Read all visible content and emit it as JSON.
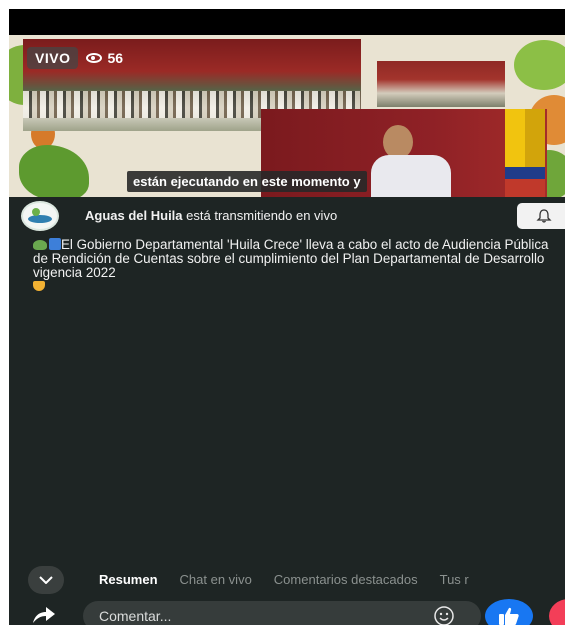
{
  "video": {
    "live_label": "VIVO",
    "viewer_count": "56",
    "caption": "están ejecutando en este momento y"
  },
  "page": {
    "name": "Aguas del Huila",
    "status_text": "está transmitiendo en vivo"
  },
  "description": "El Gobierno Departamental 'Huila Crece' lleva a cabo el acto de Audiencia Pública de Rendición de Cuentas sobre el cumplimiento del Plan Departamental de Desarrollo vigencia 2022",
  "tabs": [
    {
      "label": "Resumen",
      "active": true
    },
    {
      "label": "Chat en vivo",
      "active": false
    },
    {
      "label": "Comentarios destacados",
      "active": false
    },
    {
      "label": "Tus r",
      "active": false
    }
  ],
  "comment": {
    "placeholder": "Comentar..."
  },
  "icons": {
    "views": "eye-icon",
    "notify": "bell-icon",
    "collapse": "chevron-down-icon",
    "share": "share-arrow-icon",
    "emoji": "smiley-icon",
    "like": "thumbs-up-icon",
    "love": "heart-icon"
  },
  "colors": {
    "background": "#1e2524",
    "like": "#1877f2",
    "love": "#f33e58"
  }
}
